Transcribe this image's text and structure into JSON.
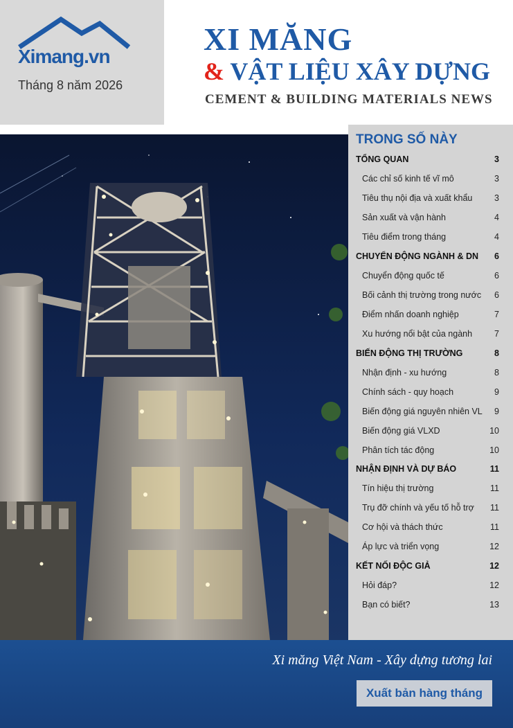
{
  "header": {
    "logo_text": "Ximang.vn",
    "issue_date": "Tháng 8 năm 2026",
    "title_line1": "XI MĂNG",
    "title_line2_amp": "&",
    "title_line2_rest": "VẬT LIỆU XÂY DỰNG",
    "title_line3": "CEMENT & BUILDING MATERIALS NEWS"
  },
  "colors": {
    "brand_blue": "#1f5aa6",
    "accent_red": "#e2231a",
    "toc_bg": "#d4d4d4",
    "band_blue": "#1c4f91"
  },
  "toc": {
    "title": "TRONG SỐ NÀY",
    "entries": [
      {
        "label": "TỔNG QUAN",
        "page": "3",
        "section": true
      },
      {
        "label": "Các chỉ số kinh tế vĩ mô",
        "page": "3"
      },
      {
        "label": "Tiêu thụ nội địa và xuất khẩu",
        "page": "3"
      },
      {
        "label": "Sản xuất và vận hành",
        "page": "4"
      },
      {
        "label": "Tiêu điểm trong tháng",
        "page": "4"
      },
      {
        "label": "CHUYỂN ĐỘNG NGÀNH & DN",
        "page": "6",
        "section": true
      },
      {
        "label": "Chuyển động quốc tế",
        "page": "6"
      },
      {
        "label": "Bối cảnh thị trường trong nước",
        "page": "6"
      },
      {
        "label": "Điểm nhấn doanh nghiệp",
        "page": "7"
      },
      {
        "label": "Xu hướng nổi bật của ngành",
        "page": "7"
      },
      {
        "label": "BIẾN ĐỘNG THỊ TRƯỜNG",
        "page": "8",
        "section": true
      },
      {
        "label": "Nhận định - xu hướng",
        "page": "8"
      },
      {
        "label": "Chính sách - quy hoạch",
        "page": "9"
      },
      {
        "label": "Biến động giá nguyên nhiên VL",
        "page": "9"
      },
      {
        "label": "Biến động giá VLXD",
        "page": "10"
      },
      {
        "label": "Phân tích tác động",
        "page": "10"
      },
      {
        "label": "NHẬN ĐỊNH VÀ DỰ BÁO",
        "page": "11",
        "section": true
      },
      {
        "label": "Tín hiệu thị trường",
        "page": "11"
      },
      {
        "label": "Trụ đỡ chính và yếu tố hỗ trợ",
        "page": "11"
      },
      {
        "label": "Cơ hội và thách thức",
        "page": "11"
      },
      {
        "label": "Áp lực và triển vọng",
        "page": "12"
      },
      {
        "label": "KẾT NỐI ĐỘC GIẢ",
        "page": "12",
        "section": true
      },
      {
        "label": "Hỏi đáp?",
        "page": "12"
      },
      {
        "label": "Bạn có biết?",
        "page": "13"
      }
    ]
  },
  "footer": {
    "slogan": "Xi măng Việt Nam - Xây dựng tương lai",
    "monthly_label": "Xuất bản hàng tháng"
  }
}
